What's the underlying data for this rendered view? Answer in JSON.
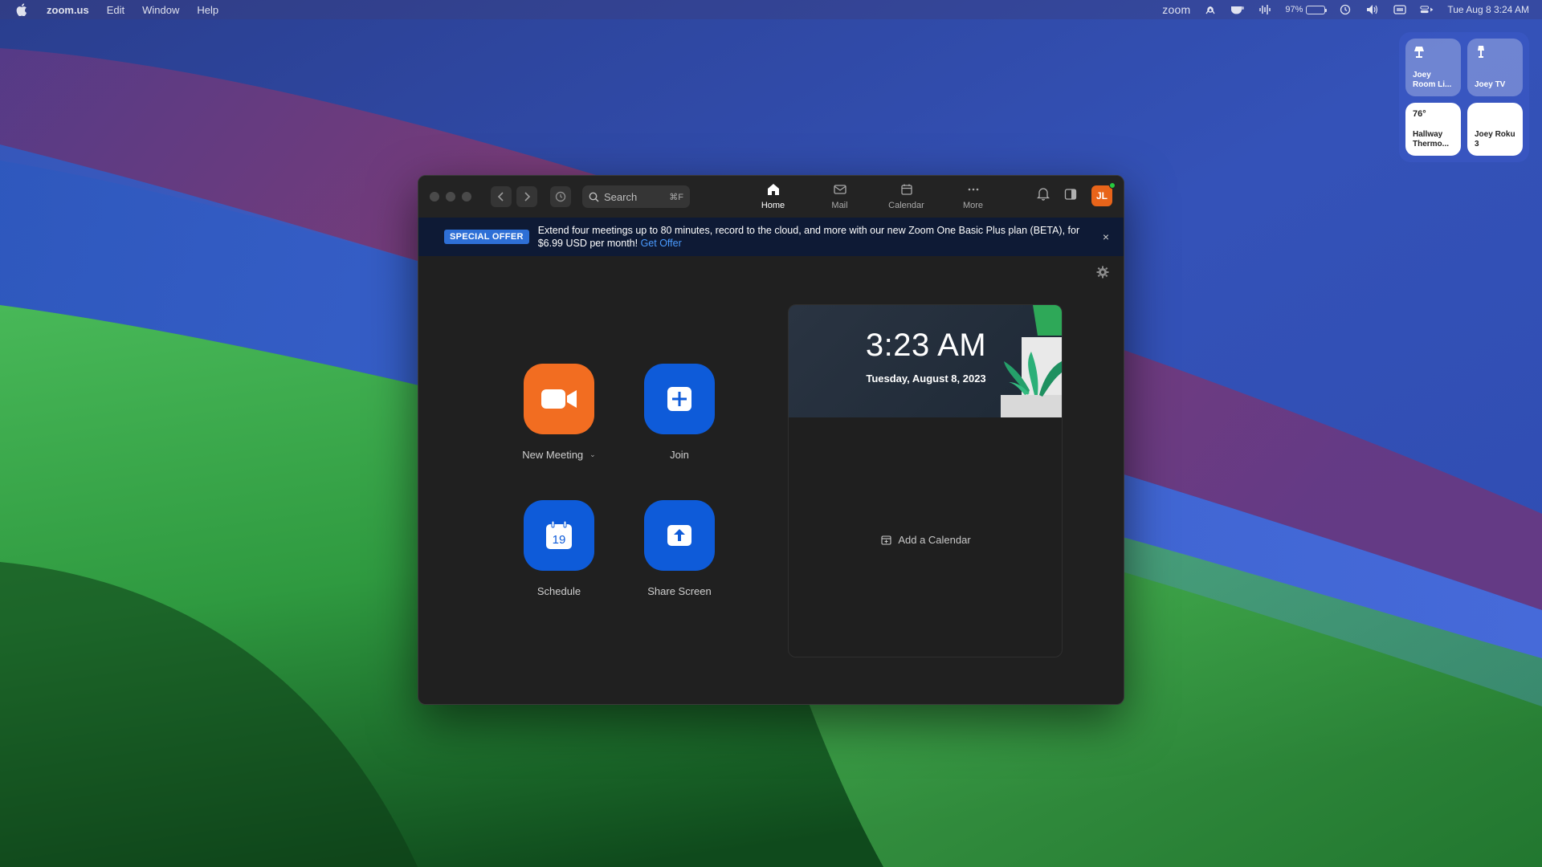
{
  "menubar": {
    "app_name": "zoom.us",
    "menus": [
      "Edit",
      "Window",
      "Help"
    ],
    "zoom_status_label": "zoom",
    "battery_percent": "97%",
    "battery_level": 0.97,
    "clock": "Tue Aug 8  3:24 AM"
  },
  "home_widget": {
    "tiles": [
      {
        "label": "Joey Room Li...",
        "icon": "lamp-icon"
      },
      {
        "label": "Joey TV",
        "icon": "lamp-icon"
      },
      {
        "label": "Hallway Thermo...",
        "value": "76°"
      },
      {
        "label": "Joey Roku 3"
      }
    ]
  },
  "window": {
    "search_placeholder": "Search",
    "search_shortcut": "⌘F",
    "tabs": [
      {
        "label": "Home",
        "icon": "home-icon",
        "active": true
      },
      {
        "label": "Mail",
        "icon": "mail-icon"
      },
      {
        "label": "Calendar",
        "icon": "calendar-icon"
      },
      {
        "label": "More",
        "icon": "more-icon"
      }
    ],
    "avatar_initials": "JL",
    "avatar_color": "#e8641a"
  },
  "banner": {
    "badge": "SPECIAL OFFER",
    "text": "Extend four meetings up to 80 minutes, record to the cloud, and more with our new Zoom One Basic Plus plan (BETA), for $6.99 USD per month!",
    "link": "Get Offer",
    "close": "×"
  },
  "actions": {
    "new_meeting": "New Meeting",
    "join": "Join",
    "schedule": "Schedule",
    "schedule_day": "19",
    "share_screen": "Share Screen",
    "colors": {
      "orange": "#f26d21",
      "blue": "#0e5bd9"
    }
  },
  "calendar_panel": {
    "time": "3:23 AM",
    "date": "Tuesday, August 8, 2023",
    "add_calendar": "Add a Calendar"
  }
}
